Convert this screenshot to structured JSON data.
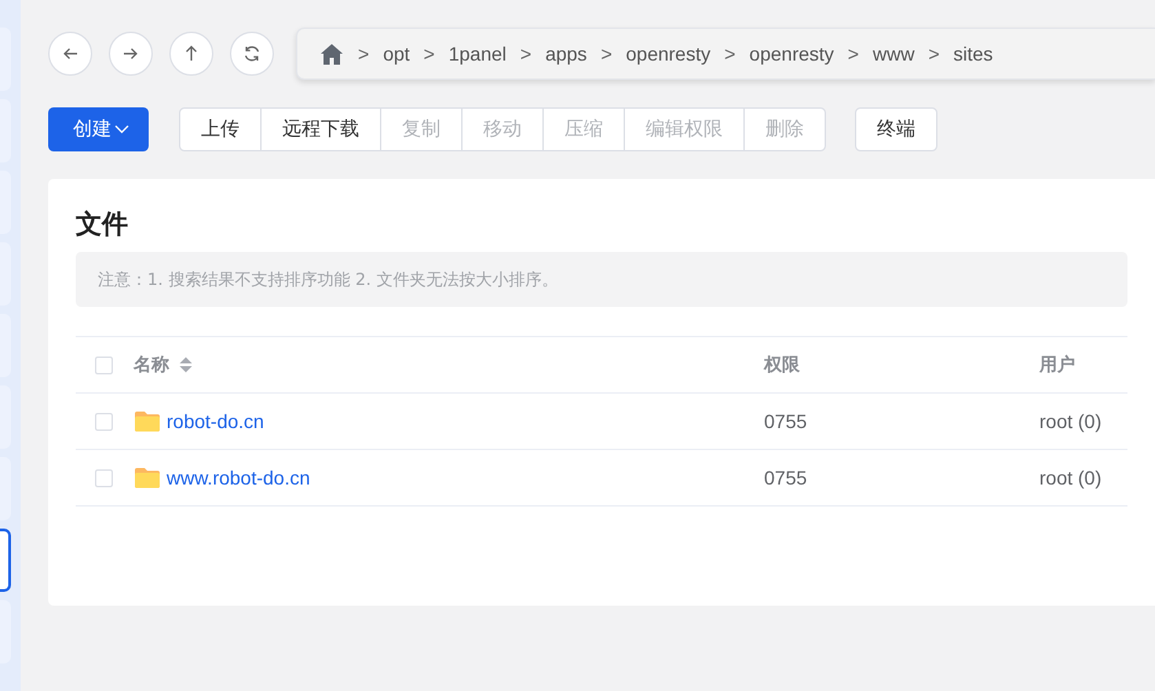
{
  "side_tabs": [
    {
      "selected": false
    },
    {
      "selected": false
    },
    {
      "selected": false
    },
    {
      "selected": false
    },
    {
      "selected": false
    },
    {
      "selected": false
    },
    {
      "selected": false
    },
    {
      "selected": true
    },
    {
      "selected": false
    }
  ],
  "nav": {
    "buttons": [
      {
        "kind": "back"
      },
      {
        "kind": "forward"
      },
      {
        "kind": "up"
      },
      {
        "kind": "refresh"
      }
    ],
    "path": [
      {
        "separator": ">",
        "label": "opt"
      },
      {
        "separator": ">",
        "label": "1panel"
      },
      {
        "separator": ">",
        "label": "apps"
      },
      {
        "separator": ">",
        "label": "openresty"
      },
      {
        "separator": ">",
        "label": "openresty"
      },
      {
        "separator": ">",
        "label": "www"
      },
      {
        "separator": ">",
        "label": "sites"
      }
    ]
  },
  "toolbar": {
    "create": "创建",
    "actions": [
      {
        "label": "上传",
        "disabled": false
      },
      {
        "label": "远程下载",
        "disabled": false
      },
      {
        "label": "复制",
        "disabled": true
      },
      {
        "label": "移动",
        "disabled": true
      },
      {
        "label": "压缩",
        "disabled": true
      },
      {
        "label": "编辑权限",
        "disabled": true
      },
      {
        "label": "删除",
        "disabled": true
      }
    ],
    "terminal": "终端"
  },
  "files": {
    "title": "文件",
    "notice": "注意：1. 搜索结果不支持排序功能 2. 文件夹无法按大小排序。",
    "header_checked": false,
    "columns": [
      {
        "label": "名称",
        "sortable": true
      },
      {
        "label": "权限",
        "sortable": false
      },
      {
        "label": "用户",
        "sortable": false
      }
    ],
    "rows": [
      {
        "checked": false,
        "name": "robot-do.cn",
        "mode": "0755",
        "user": "root (0)"
      },
      {
        "checked": false,
        "name": "www.robot-do.cn",
        "mode": "0755",
        "user": "root (0)"
      }
    ]
  }
}
